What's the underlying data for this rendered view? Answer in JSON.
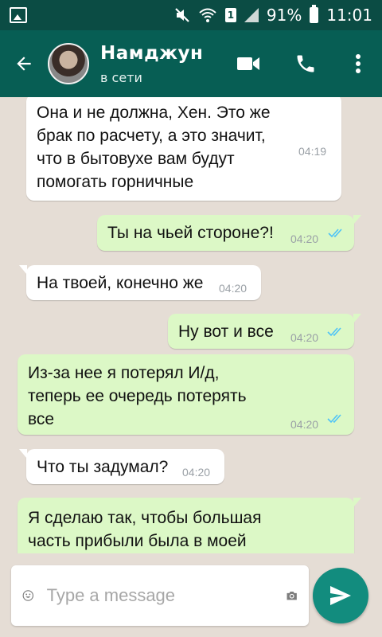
{
  "status_bar": {
    "battery": "91%",
    "time": "11:01",
    "sim_label": "1"
  },
  "header": {
    "contact_name": "Намджун",
    "contact_status": "в сети",
    "back_icon": "arrow-left-icon",
    "video_icon": "video-camera-icon",
    "call_icon": "phone-icon",
    "menu_icon": "more-vertical-icon"
  },
  "messages": [
    {
      "direction": "in",
      "text": "Она и не должна, Хен. Это же\nбрак по расчету, а это значит,\nчто в бытовухе вам будут\nпомогать горничные",
      "time": "04:19"
    },
    {
      "direction": "out",
      "text": "Ты на чьей стороне?!",
      "time": "04:20",
      "read": true
    },
    {
      "direction": "in",
      "text": "На твоей, конечно же",
      "time": "04:20"
    },
    {
      "direction": "out",
      "text": "Ну вот и все",
      "time": "04:20",
      "read": true
    },
    {
      "direction": "out",
      "text": "Из-за нее я потерял И/д,\nтеперь ее очередь потерять\nвсе",
      "time": "04:20",
      "read": true
    },
    {
      "direction": "in",
      "text": "Что ты задумал?",
      "time": "04:20"
    },
    {
      "direction": "out",
      "text": "Я сделаю так, чтобы большая\nчасть прибыли была в моей",
      "time": ""
    }
  ],
  "composer": {
    "placeholder": "Type a message",
    "emoji_icon": "emoji-icon",
    "camera_icon": "camera-icon",
    "send_icon": "send-icon"
  },
  "colors": {
    "status_bar": "#0b4c44",
    "app_bar": "#075e54",
    "chat_background": "#e5ddd5",
    "outgoing_bubble": "#dcf8c6",
    "incoming_bubble": "#ffffff",
    "read_tick": "#4fc3f7",
    "send_button": "#128c7e"
  }
}
